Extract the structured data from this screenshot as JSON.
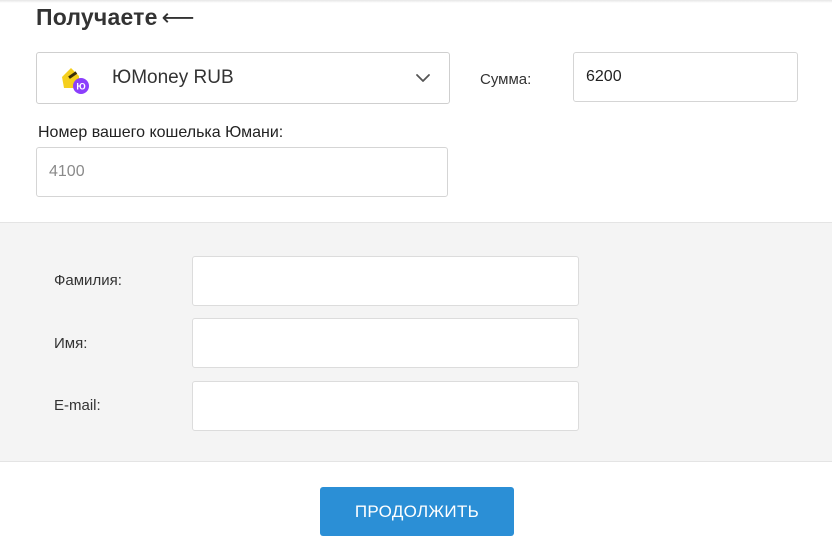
{
  "receive": {
    "title": "Получаете",
    "arrow": "⟵"
  },
  "currency": {
    "name": "ЮMoney RUB",
    "logo_icon": "yoomoney-logo-icon",
    "logo_badge": "Ю",
    "chevron_icon": "chevron-down-icon"
  },
  "amount": {
    "label": "Сумма:",
    "value": "6200"
  },
  "wallet": {
    "label": "Номер вашего кошелька Юмани:",
    "placeholder": "4100"
  },
  "personal": {
    "surname_label": "Фамилия:",
    "name_label": "Имя:",
    "email_label": "E-mail:"
  },
  "actions": {
    "continue_label": "ПРОДОЛЖИТЬ"
  },
  "colors": {
    "accent": "#2b8fd6",
    "logo_yellow": "#f5cf1e",
    "logo_purple": "#8b3ffc",
    "panel_bg": "#f4f4f4"
  }
}
